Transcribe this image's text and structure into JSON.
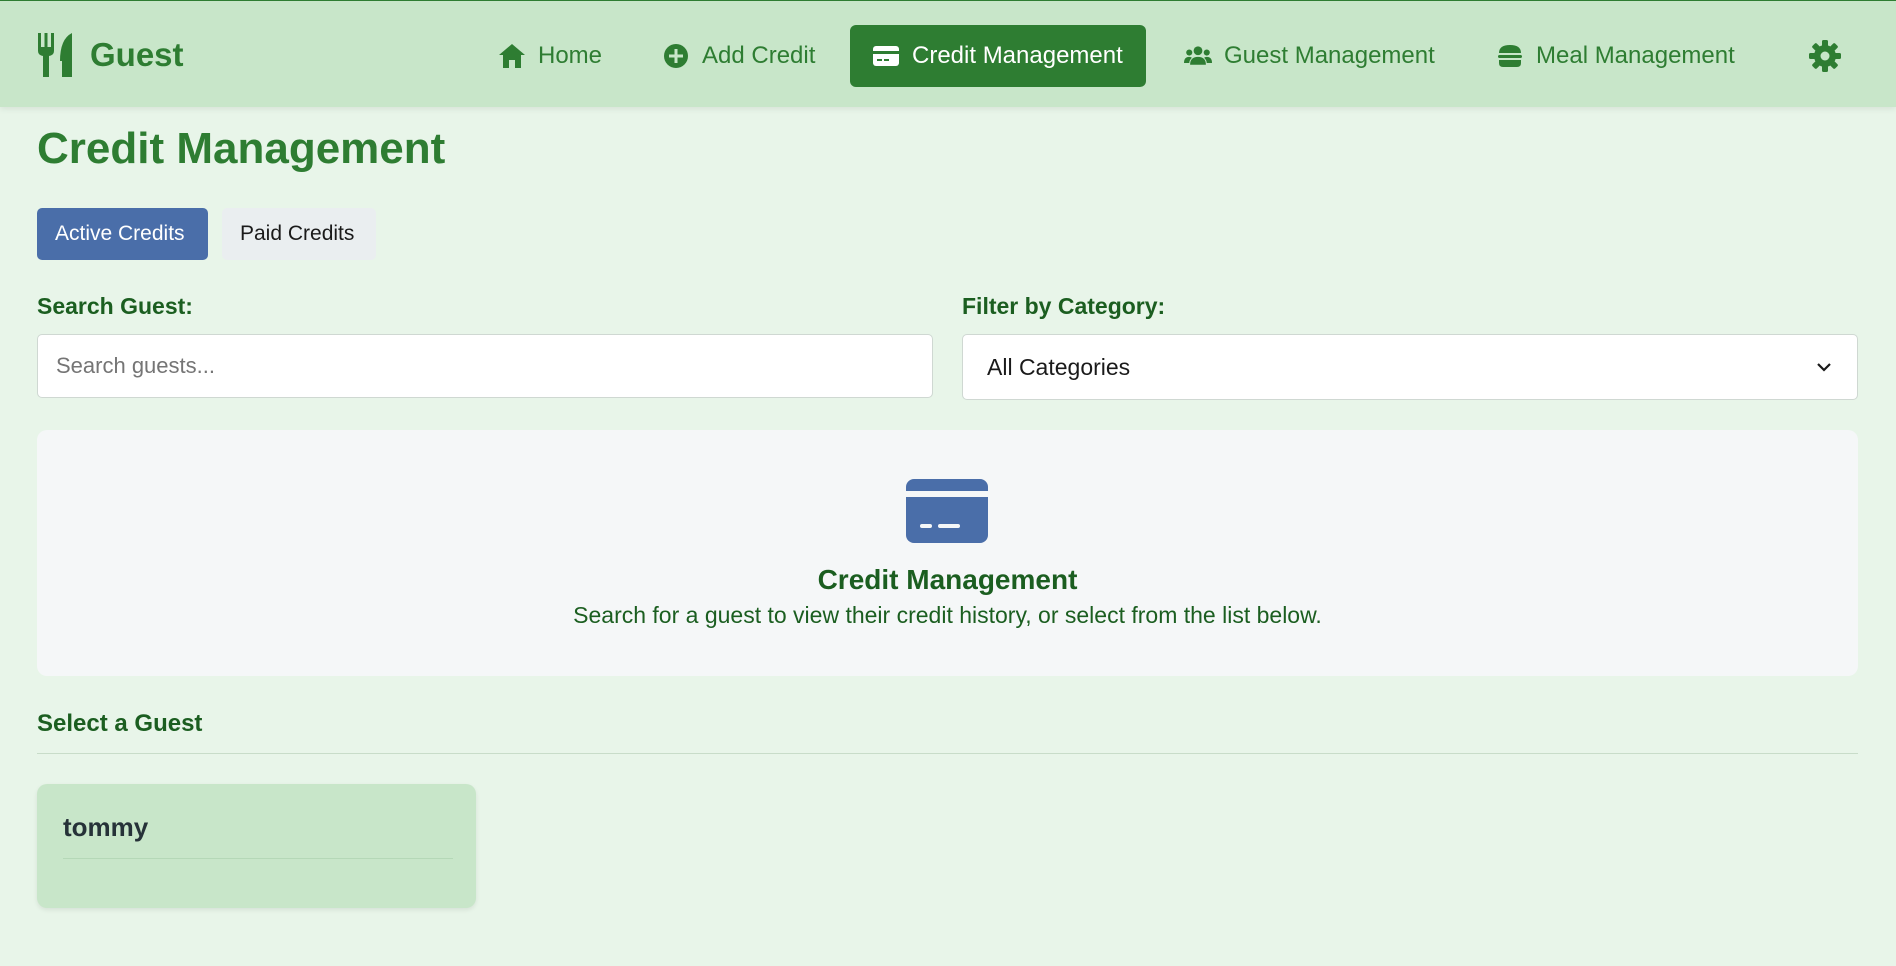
{
  "brand": {
    "name": "Guest",
    "icon": "utensils-icon"
  },
  "nav": {
    "items": [
      {
        "label": "Home",
        "icon": "home-icon"
      },
      {
        "label": "Add Credit",
        "icon": "plus-circle-icon"
      },
      {
        "label": "Credit Management",
        "icon": "credit-card-icon",
        "active": true
      },
      {
        "label": "Guest Management",
        "icon": "users-icon"
      },
      {
        "label": "Meal Management",
        "icon": "burger-icon"
      }
    ],
    "settings_icon": "gear-icon"
  },
  "page": {
    "title": "Credit Management"
  },
  "tabs": {
    "active": "Active Credits",
    "paid": "Paid Credits"
  },
  "search": {
    "label": "Search Guest:",
    "placeholder": "Search guests..."
  },
  "filter": {
    "label": "Filter by Category:",
    "selected": "All Categories"
  },
  "info": {
    "icon": "credit-card-icon",
    "title": "Credit Management",
    "subtitle": "Search for a guest to view their credit history, or select from the list below."
  },
  "guests": {
    "section_title": "Select a Guest",
    "items": [
      {
        "name": "tommy"
      }
    ]
  },
  "colors": {
    "primary_green": "#2e7d32",
    "nav_bg": "#c8e6c9",
    "page_bg": "#e8f5e9",
    "tab_active": "#4a6ea9",
    "icon_blue": "#4a6ea9"
  }
}
